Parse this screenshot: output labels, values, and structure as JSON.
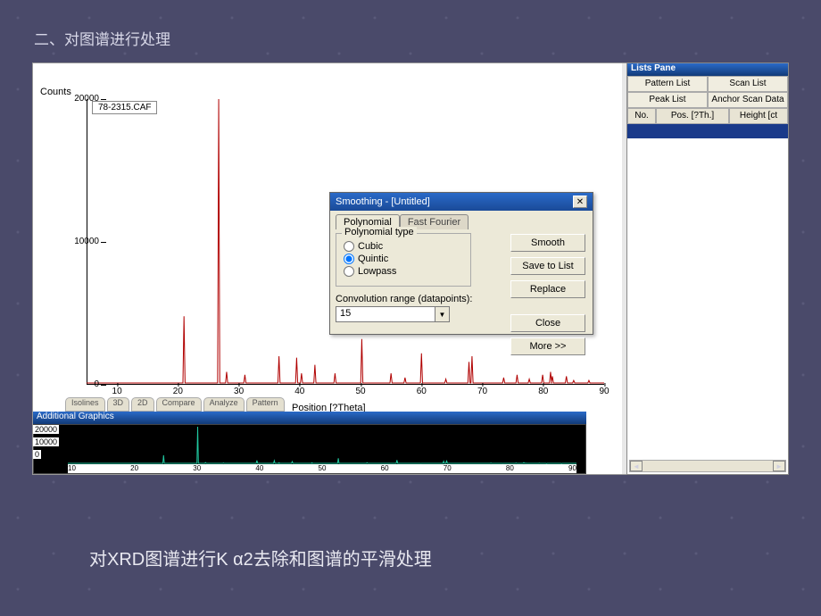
{
  "slide_title": "二、对图谱进行处理",
  "caption_text": "对XRD图谱进行K α2去除和图谱的平滑处理",
  "chart_data": {
    "type": "line",
    "title": "",
    "ylabel": "Counts",
    "xlabel": "Position [?Theta]",
    "file_label": "78-2315.CAF",
    "ylim": [
      0,
      20000
    ],
    "xlim": [
      5,
      90
    ],
    "xticks": [
      10,
      20,
      30,
      40,
      50,
      60,
      70,
      80,
      90
    ],
    "yticks": [
      0,
      10000,
      20000
    ],
    "series": [
      {
        "name": "78-2315.CAF",
        "peaks": [
          {
            "x": 21.0,
            "y": 4800
          },
          {
            "x": 26.7,
            "y": 20000
          },
          {
            "x": 28.0,
            "y": 900
          },
          {
            "x": 31.0,
            "y": 700
          },
          {
            "x": 36.6,
            "y": 2000
          },
          {
            "x": 39.5,
            "y": 1900
          },
          {
            "x": 40.3,
            "y": 800
          },
          {
            "x": 42.5,
            "y": 1400
          },
          {
            "x": 45.8,
            "y": 800
          },
          {
            "x": 50.2,
            "y": 3200
          },
          {
            "x": 55.0,
            "y": 800
          },
          {
            "x": 57.3,
            "y": 500
          },
          {
            "x": 60.0,
            "y": 2200
          },
          {
            "x": 64.0,
            "y": 400
          },
          {
            "x": 67.8,
            "y": 1600
          },
          {
            "x": 68.3,
            "y": 2000
          },
          {
            "x": 73.5,
            "y": 500
          },
          {
            "x": 75.7,
            "y": 700
          },
          {
            "x": 77.7,
            "y": 400
          },
          {
            "x": 79.9,
            "y": 700
          },
          {
            "x": 81.2,
            "y": 900
          },
          {
            "x": 81.5,
            "y": 600
          },
          {
            "x": 83.8,
            "y": 600
          },
          {
            "x": 85.0,
            "y": 300
          },
          {
            "x": 87.5,
            "y": 300
          }
        ]
      }
    ]
  },
  "dialog": {
    "title": "Smoothing - [Untitled]",
    "tab_poly": "Polynomial",
    "tab_fft": "Fast Fourier",
    "group_label": "Polynomial type",
    "radio_cubic": "Cubic",
    "radio_quintic": "Quintic",
    "radio_lowpass": "Lowpass",
    "selected_radio": "Quintic",
    "conv_label": "Convolution range (datapoints):",
    "conv_value": "15",
    "btn_smooth": "Smooth",
    "btn_save": "Save to List",
    "btn_replace": "Replace",
    "btn_close": "Close",
    "btn_more": "More >>"
  },
  "bottom_tabs": {
    "t1": "Isolines",
    "t2": "3D",
    "t3": "2D",
    "t4": "Compare",
    "t5": "Analyze",
    "t6": "Pattern"
  },
  "addl_title": "Additional Graphics",
  "mini_y": {
    "y0": "0",
    "y1": "10000",
    "y2": "20000"
  },
  "mini_x": [
    "10",
    "20",
    "30",
    "40",
    "50",
    "60",
    "70",
    "80",
    "90"
  ],
  "lists": {
    "pane_title": "Lists Pane",
    "tab_pattern": "Pattern List",
    "tab_scan": "Scan List",
    "tab_peak": "Peak List",
    "tab_anchor": "Anchor Scan Data",
    "col_no": "No.",
    "col_pos": "Pos. [?Th.]",
    "col_height": "Height [ct"
  }
}
